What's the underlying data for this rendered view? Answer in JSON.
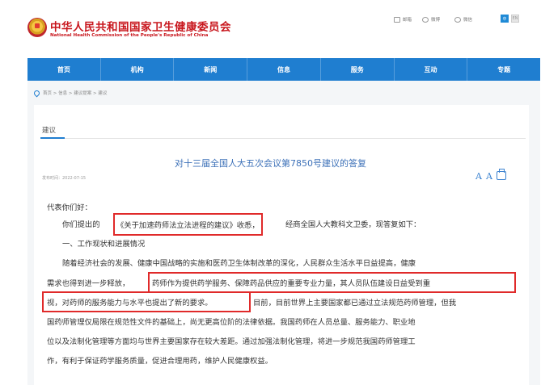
{
  "header": {
    "site_title": "中华人民共和国国家卫生健康委员会",
    "site_subtitle": "National Health Commission of the People's Republic of China",
    "share": [
      {
        "icon": "mail-icon",
        "label": "邮箱"
      },
      {
        "icon": "weibo-icon",
        "label": "微博"
      },
      {
        "icon": "wechat-icon",
        "label": "微信"
      }
    ],
    "lang_zh": "中",
    "lang_en": "EN"
  },
  "nav": {
    "items": [
      "首页",
      "机构",
      "新闻",
      "信息",
      "服务",
      "互动",
      "专题"
    ]
  },
  "breadcrumb": "首页 > 信息 > 建议提案 > 建议",
  "section_label": "建议",
  "article": {
    "title": "对十三届全国人大五次会议第7850号建议的答复",
    "publish_date": "发布时间：2022-07-15",
    "font_larger": "A",
    "font_smaller": "A",
    "paragraphs": {
      "p1": "代表你们好：",
      "p2_a": "你们提出的",
      "p2_b": "《关于加速药师法立法进程的建议》收悉，",
      "p2_c": "经商全国人大教科文卫委，现答复如下：",
      "p3": "一、工作现状和进展情况",
      "p4": "随着经济社会的发展、健康中国战略的实施和医药卫生体制改革的深化，人民群众生活水平日益提高，健康",
      "p5_a": "需求也得到进一步释放，",
      "p5_b": "药师作为提供药学服务、保障药品供应的重要专业力量，其人员队伍建设日益受到重",
      "p6_a": "视，对药师的服务能力与水平也提出了新的要求。",
      "p6_b": "目前，目前世界上主要国家都已通过立法规范药师管理，但我",
      "p7": "国药师管理仅局限在规范性文件的基础上，尚无更高位阶的法律依据。我国药师在人员总量、服务能力、职业地",
      "p8": "位以及法制化管理等方面均与世界主要国家存在较大差距。通过加强法制化管理，将进一步规范我国药师管理工",
      "p9": "作，有利于保证药学服务质量，促进合理用药，维护人民健康权益。"
    }
  },
  "colors": {
    "brand_red": "#c8161d",
    "nav_blue": "#1f7ed0",
    "title_blue": "#3d71b8",
    "highlight_red": "#e02a2a"
  }
}
